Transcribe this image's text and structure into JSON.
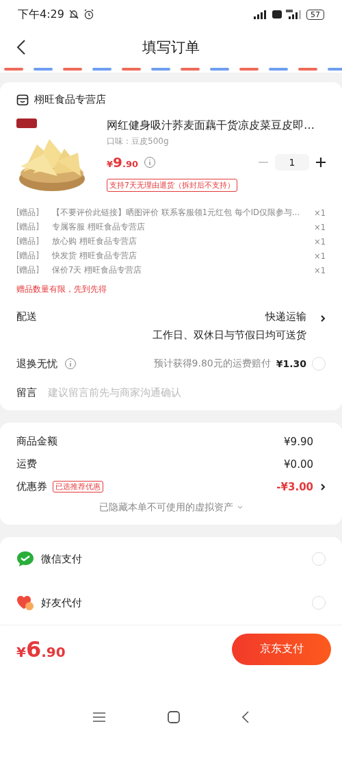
{
  "status_bar": {
    "time": "下午4:29",
    "battery": "57"
  },
  "header": {
    "title": "填写订单"
  },
  "store": {
    "name": "栩旺食品专营店"
  },
  "product": {
    "kind": "picture",
    "title": "网红健身吸汁荞麦面藕干货凉皮菜豆皮即…",
    "spec": "口味：豆皮500g",
    "price": {
      "currency": "¥",
      "integer": "9",
      "decimal": ".90"
    },
    "quantity": "1",
    "minus_disabled": true,
    "return_tag": "支持7天无理由退货（拆封后不支持）"
  },
  "gifts": [
    {
      "tag": "[赠品]",
      "name": "【不要评价此链接】晒图评价 联系客服领1元红包 每个ID仅限参与…",
      "qty": "×1"
    },
    {
      "tag": "[赠品]",
      "name": "专属客服 栩旺食品专营店",
      "qty": "×1"
    },
    {
      "tag": "[赠品]",
      "name": "放心购 栩旺食品专营店",
      "qty": "×1"
    },
    {
      "tag": "[赠品]",
      "name": "快发货 栩旺食品专营店",
      "qty": "×1"
    },
    {
      "tag": "[赠品]",
      "name": "保价7天 栩旺食品专营店",
      "qty": "×1"
    }
  ],
  "gift_notice": "赠品数量有限，先到先得",
  "delivery": {
    "label": "配送",
    "method": "快递运输",
    "note": "工作日、双休日与节假日均可送货"
  },
  "return_insurance": {
    "label": "退换无忧",
    "description": "预计获得9.80元的运费赔付",
    "price": "¥1.30",
    "selected": false
  },
  "message": {
    "label": "留言",
    "placeholder": "建议留言前先与商家沟通确认"
  },
  "summary": [
    {
      "kind": "plain",
      "label": "商品金额",
      "value": "¥9.90"
    },
    {
      "kind": "plain",
      "label": "运费",
      "value": "¥0.00"
    },
    {
      "kind": "coupon",
      "label": "优惠券",
      "tag": "已选推荐优惠",
      "value": "-¥3.00"
    }
  ],
  "hidden_assets": "已隐藏本单不可使用的虚拟资产",
  "payment_methods": [
    {
      "kind": "wechat",
      "label": "微信支付",
      "selected": false
    },
    {
      "kind": "friend",
      "label": "好友代付",
      "selected": false
    }
  ],
  "footer": {
    "currency": "¥",
    "integer": "6",
    "decimal": ".90",
    "pay_button": "京东支付"
  }
}
